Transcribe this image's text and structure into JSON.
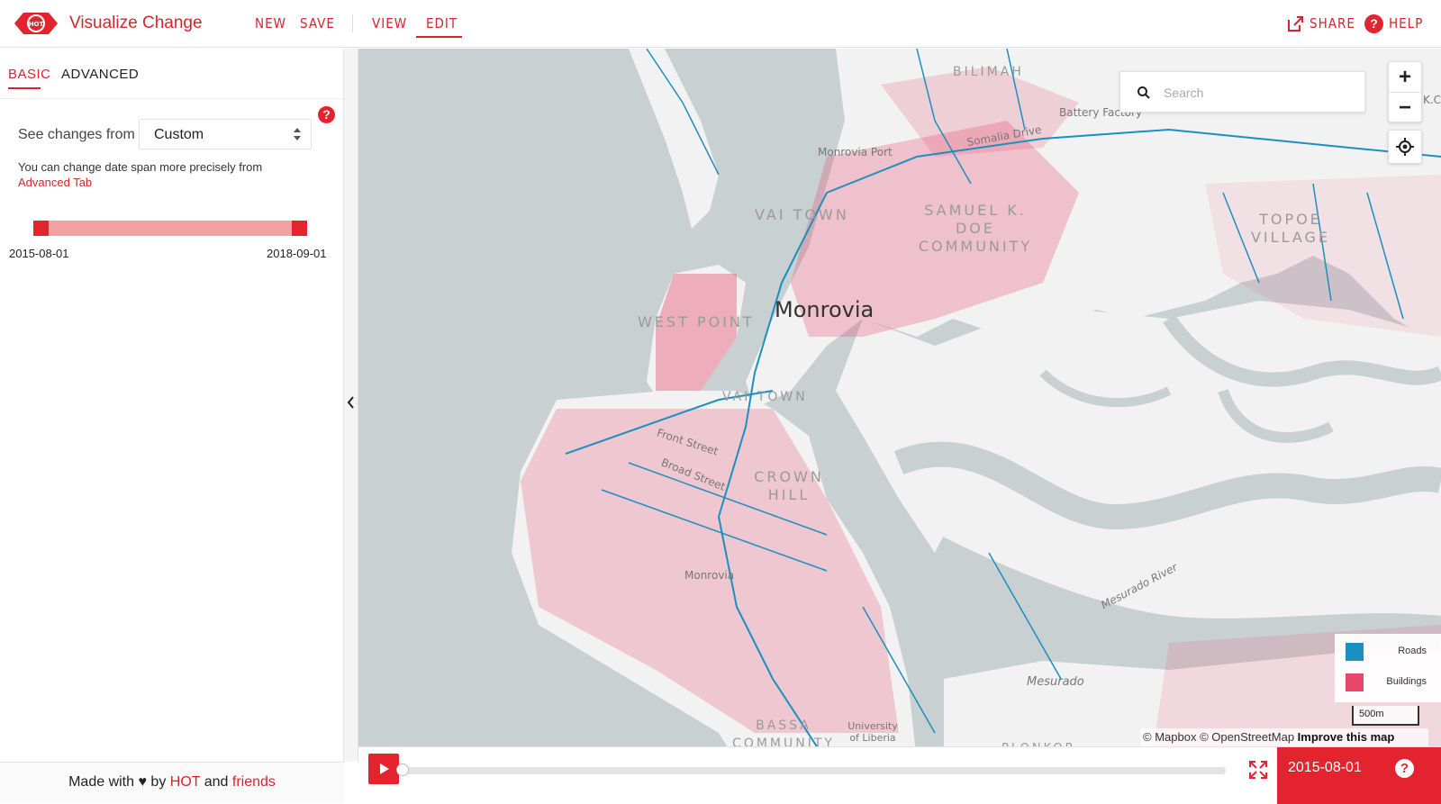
{
  "app": {
    "title": "Visualize Change",
    "logo_text": "HOT"
  },
  "nav": {
    "new": "NEW",
    "save": "SAVE",
    "view": "VIEW",
    "edit": "EDIT",
    "share": "SHARE",
    "help": "HELP"
  },
  "sidebar": {
    "tabs": [
      "BASIC",
      "ADVANCED"
    ],
    "changes_label": "See changes from",
    "select_value": "Custom",
    "hint": "You can change date span more precisely from",
    "hint_link": "Advanced Tab",
    "help_icon": "?",
    "range_start": "2015-08-01",
    "range_end": "2018-09-01",
    "footer": {
      "prefix": "Made with",
      "heart": "♥",
      "by": "by",
      "hot": "HOT",
      "and": "and",
      "friends": "friends"
    }
  },
  "map": {
    "search_placeholder": "Search",
    "zoom_in": "+",
    "zoom_out": "−",
    "labels": {
      "bilimah": "BILIMAH",
      "battery_factory": "Battery Factory",
      "somalia_drive": "Somalia Drive",
      "monrovia_port": "Monrovia Port",
      "vai_town_top": "VAI TOWN",
      "samuel_doe": "SAMUEL K. DOE COMMUNITY",
      "topoe_village": "TOPOE VILLAGE",
      "west_point": "WEST POINT",
      "city": "Monrovia",
      "vai_town": "VAI TOWN",
      "front_street": "Front Street",
      "broad_street": "Broad Street",
      "crown_hill": "CROWN HILL",
      "monrovia_small": "Monrovia",
      "mesurado_river": "Mesurado River",
      "mesurado": "Mesurado",
      "bassa_community": "BASSA COMMUNITY",
      "university": "University of Liberia",
      "plonkor": "PLONKOR",
      "edge_k": "K.C"
    },
    "legend": [
      {
        "label": "Roads",
        "color": "#1b8fc0"
      },
      {
        "label": "Buildings",
        "color": "#e8466b"
      }
    ],
    "scale": "500m",
    "attribution": {
      "mapbox": "© Mapbox",
      "osm": "© OpenStreetMap",
      "improve": "Improve this map"
    }
  },
  "timeline": {
    "date": "2015-08-01",
    "help": "?",
    "progress_fraction": 0.0
  },
  "colors": {
    "accent": "#e3232e",
    "water": "#c8d0d1",
    "land": "#f2f2f2",
    "roads": "#1b8fc0",
    "buildings": "#e8466b"
  }
}
